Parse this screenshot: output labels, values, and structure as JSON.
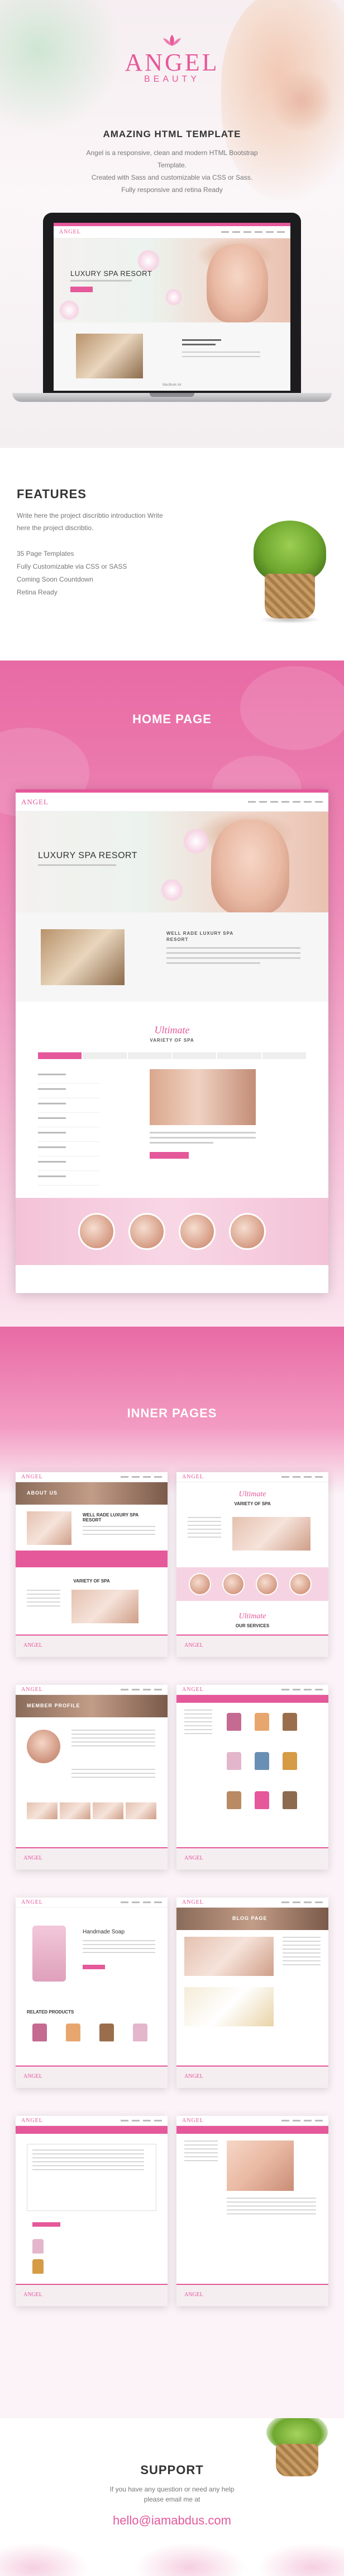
{
  "brand": {
    "name": "ANGEL",
    "tagline": "BEAUTY"
  },
  "hero": {
    "title": "AMAZING HTML TEMPLATE",
    "description_lines": [
      "Angel is a responsive, clean and modern HTML Bootstrap Template.",
      "Created with Sass and customizable via CSS or Sass.",
      "Fully responsive and retina Ready"
    ]
  },
  "mockup": {
    "hero_text": "LUXURY SPA RESORT",
    "laptop_label": "MacBook Air"
  },
  "features": {
    "title": "FEATURES",
    "intro_lines": [
      "Write here the project discribtio introduction Write",
      "here the project discribtio."
    ],
    "items": [
      "35 Page Templates",
      "Fully Customizable via CSS or SASS",
      "Coming Soon Countdown",
      "Retina Ready"
    ]
  },
  "home_section": {
    "title": "HOME PAGE",
    "hero_text": "LUXURY SPA RESORT",
    "about_heading": "WELL RADE LUXURY SPA RESORT",
    "spa_script": "Ultimate",
    "spa_heading": "VARIETY OF SPA"
  },
  "inner_section": {
    "title": "INNER PAGES",
    "pages": {
      "about": "ABOUT US",
      "about_heading": "WELL RADE LUXURY SPA RESORT",
      "about_spa": "VARIETY OF SPA",
      "member": "MEMBER PROFILE",
      "blog": "BLOG PAGE",
      "product": "Handmade Soap",
      "related": "RELATED PRODUCTS",
      "script1": "Ultimate",
      "script2": "Ultimate",
      "spa2": "VARIETY OF SPA",
      "spa3": "OUR SERVICES"
    }
  },
  "support": {
    "title": "SUPPORT",
    "line1": "If you have any question or need any help",
    "line2": "please email me at",
    "email": "hello@iamabdus.com"
  },
  "colors": {
    "accent": "#e5589a",
    "pink_band": "#e86aa4",
    "text_dark": "#333333",
    "text_body": "#777777"
  },
  "icons": [
    "lotus-icon"
  ]
}
